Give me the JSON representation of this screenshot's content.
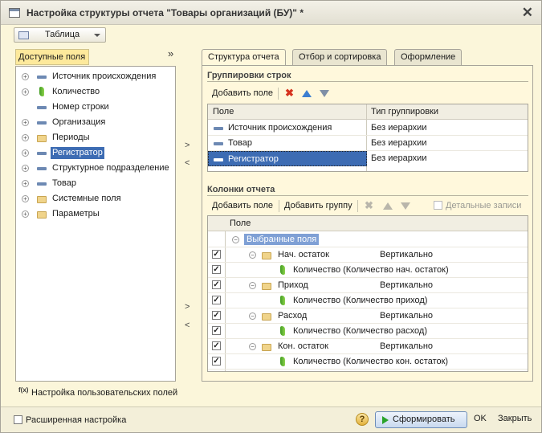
{
  "window": {
    "title": "Настройка структуры отчета \"Товары организаций (БУ)\" *"
  },
  "view_dropdown": {
    "value": "Таблица"
  },
  "left_panel": {
    "label": "Доступные поля",
    "more": "»",
    "items": [
      {
        "label": "Источник происхождения",
        "icon": "field-icon",
        "expandable": true
      },
      {
        "label": "Количество",
        "icon": "resource-icon",
        "expandable": true
      },
      {
        "label": "Номер строки",
        "icon": "field-icon",
        "expandable": false
      },
      {
        "label": "Организация",
        "icon": "field-icon",
        "expandable": true
      },
      {
        "label": "Периоды",
        "icon": "folder-icon",
        "expandable": true
      },
      {
        "label": "Регистратор",
        "icon": "field-icon",
        "expandable": true,
        "selected": true
      },
      {
        "label": "Структурное подразделение",
        "icon": "field-icon",
        "expandable": true
      },
      {
        "label": "Товар",
        "icon": "field-icon",
        "expandable": true
      },
      {
        "label": "Системные поля",
        "icon": "folder-icon",
        "expandable": true
      },
      {
        "label": "Параметры",
        "icon": "folder-icon",
        "expandable": true
      }
    ],
    "custom_fields_link": "Настройка пользовательских полей",
    "fx_label": "f(x)"
  },
  "move_buttons": {
    "add": ">",
    "remove": "<"
  },
  "tabs": [
    {
      "label": "Структура отчета",
      "active": true
    },
    {
      "label": "Отбор и сортировка",
      "active": false
    },
    {
      "label": "Оформление",
      "active": false
    }
  ],
  "row_groups": {
    "title": "Группировки строк",
    "add_button": "Добавить поле",
    "columns": [
      "Поле",
      "Тип группировки"
    ],
    "rows": [
      {
        "field": "Источник происхождения",
        "type": "Без иерархии"
      },
      {
        "field": "Товар",
        "type": "Без иерархии"
      },
      {
        "field": "Регистратор",
        "type": "Без иерархии",
        "selected": true
      }
    ]
  },
  "report_columns": {
    "title": "Колонки отчета",
    "add_field_button": "Добавить поле",
    "add_group_button": "Добавить группу",
    "detail_records": "Детальные записи",
    "column_header": "Поле",
    "root": "Выбранные поля",
    "rows": [
      {
        "label": "Нач. остаток",
        "layout": "Вертикально",
        "level": 1
      },
      {
        "label": "Количество (Количество нач. остаток)",
        "level": 2
      },
      {
        "label": "Приход",
        "layout": "Вертикально",
        "level": 1
      },
      {
        "label": "Количество (Количество приход)",
        "level": 2
      },
      {
        "label": "Расход",
        "layout": "Вертикально",
        "level": 1
      },
      {
        "label": "Количество (Количество расход)",
        "level": 2
      },
      {
        "label": "Кон. остаток",
        "layout": "Вертикально",
        "level": 1
      },
      {
        "label": "Количество (Количество кон. остаток)",
        "level": 2
      }
    ]
  },
  "footer": {
    "extended": "Расширенная настройка",
    "help": "?",
    "generate": "Сформировать",
    "ok": "OK",
    "close": "Закрыть"
  }
}
